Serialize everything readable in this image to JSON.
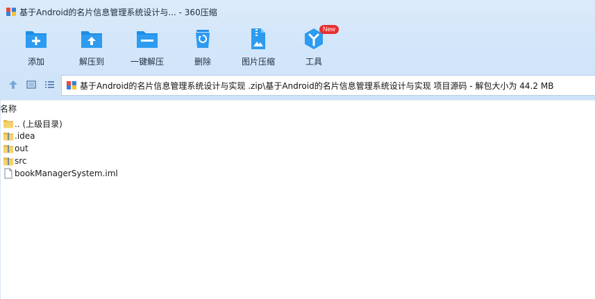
{
  "window": {
    "title": "基于Android的名片信息管理系统设计与... - 360压缩",
    "app_icon": "archive-icon"
  },
  "toolbar": {
    "items": [
      {
        "label": "添加",
        "icon": "add-folder-icon"
      },
      {
        "label": "解压到",
        "icon": "extract-to-icon"
      },
      {
        "label": "一键解压",
        "icon": "one-click-extract-icon"
      },
      {
        "label": "删除",
        "icon": "recycle-bin-icon"
      },
      {
        "label": "图片压缩",
        "icon": "image-compress-icon"
      },
      {
        "label": "工具",
        "icon": "tools-icon",
        "badge": "New"
      }
    ]
  },
  "nav": {
    "up_icon": "up-arrow-icon",
    "view_icon": "view-mode-icon",
    "list_icon": "list-view-icon",
    "path": "基于Android的名片信息管理系统设计与实现 .zip\\基于Android的名片信息管理系统设计与实现 项目源码 - 解包大小为 44.2 MB"
  },
  "list": {
    "column_name": "名称",
    "rows": [
      {
        "name": ".. (上级目录)",
        "icon": "folder-icon"
      },
      {
        "name": ".idea",
        "icon": "zip-folder-icon"
      },
      {
        "name": "out",
        "icon": "zip-folder-icon"
      },
      {
        "name": "src",
        "icon": "zip-folder-icon"
      },
      {
        "name": "bookManagerSystem.iml",
        "icon": "file-icon"
      }
    ]
  },
  "colors": {
    "accent": "#1e8ee6",
    "chrome_bg": "#d3e6fa",
    "badge": "#e8302e",
    "folder": "#f5d26b"
  }
}
